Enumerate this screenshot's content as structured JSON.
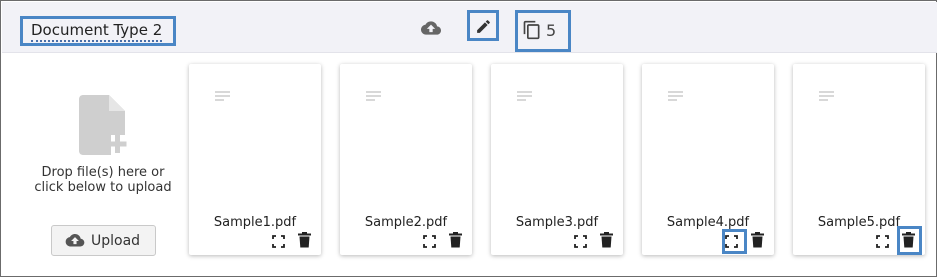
{
  "header": {
    "title": "Document Type 2",
    "upload_icon": "cloud-upload-icon",
    "edit_icon": "pencil-icon",
    "copy_icon": "copy-pages-icon",
    "page_count": "5"
  },
  "dropzone": {
    "icon": "add-file-icon",
    "text": "Drop file(s) here or click below to upload",
    "button_label": "Upload",
    "button_icon": "cloud-upload-icon"
  },
  "documents": [
    {
      "filename": "Sample1.pdf"
    },
    {
      "filename": "Sample2.pdf"
    },
    {
      "filename": "Sample3.pdf"
    },
    {
      "filename": "Sample4.pdf"
    },
    {
      "filename": "Sample5.pdf"
    }
  ],
  "colors": {
    "highlight": "#4a86c5",
    "header_bg": "#f2f2f7",
    "icon_dark": "#222222",
    "icon_gray": "#666666"
  }
}
